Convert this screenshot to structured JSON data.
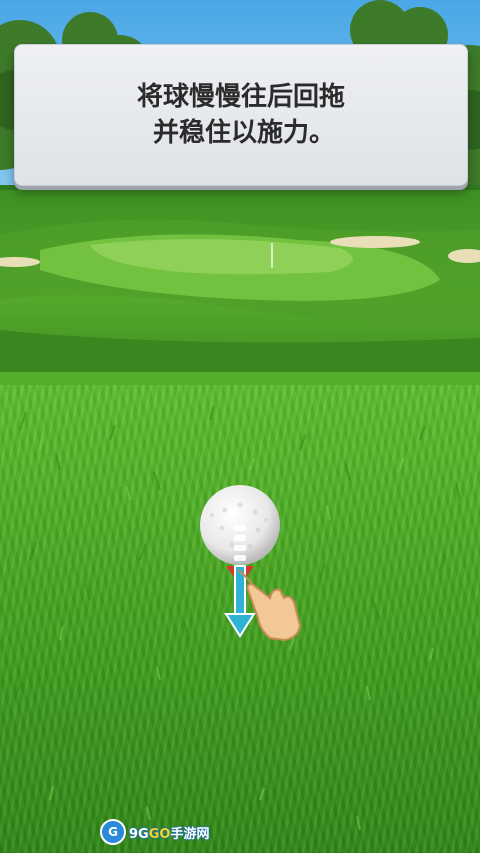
{
  "tutorial": {
    "instruction_line1": "将球慢慢往后回拖",
    "instruction_line2": "并稳住以施力。"
  },
  "watermark": {
    "text_prefix": "9G",
    "text_highlight": "GO",
    "text_suffix": "手游网"
  },
  "colors": {
    "sky": "#4aa7e6",
    "grass": "#4fb027",
    "panel": "#e6e8ec",
    "arrow": "#2fb2d6"
  },
  "icons": {
    "ball": "golf-ball-icon",
    "tee": "golf-tee-icon",
    "hand": "pointing-hand-icon",
    "arrow": "drag-down-arrow-icon"
  }
}
